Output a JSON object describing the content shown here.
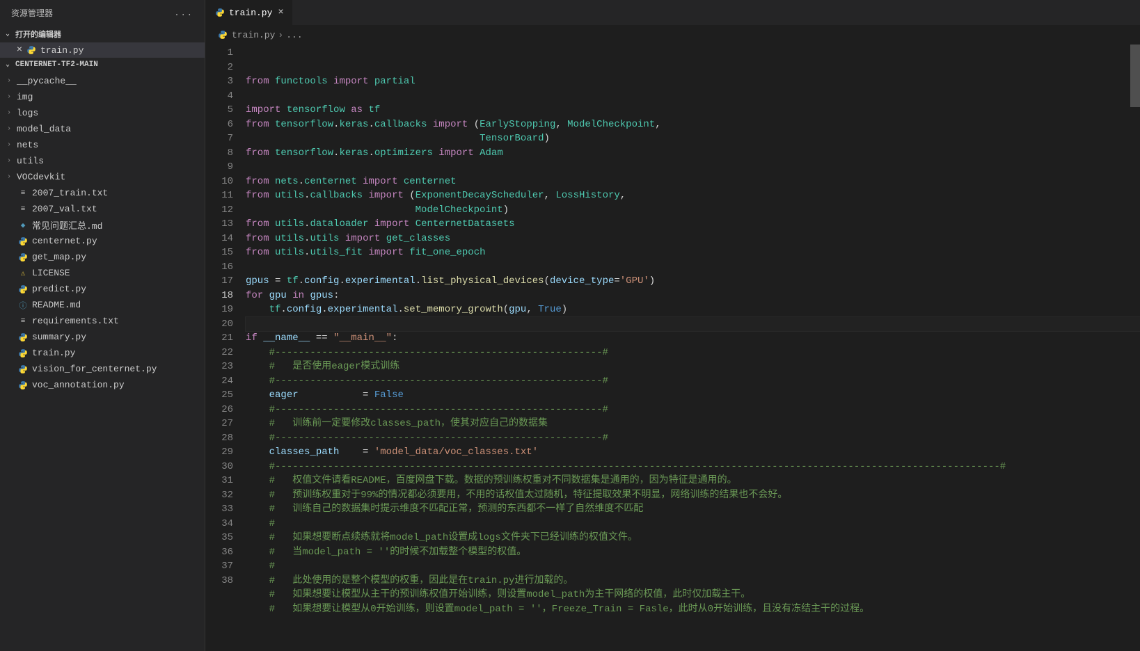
{
  "sidebar": {
    "title": "资源管理器",
    "moreActions": "...",
    "openEditors": {
      "label": "打开的编辑器",
      "items": [
        {
          "name": "train.py",
          "icon": "python"
        }
      ]
    },
    "project": {
      "name": "CENTERNET-TF2-MAIN",
      "tree": [
        {
          "type": "folder",
          "name": "__pycache__"
        },
        {
          "type": "folder",
          "name": "img"
        },
        {
          "type": "folder",
          "name": "logs"
        },
        {
          "type": "folder",
          "name": "model_data"
        },
        {
          "type": "folder",
          "name": "nets"
        },
        {
          "type": "folder",
          "name": "utils"
        },
        {
          "type": "folder",
          "name": "VOCdevkit"
        },
        {
          "type": "file",
          "name": "2007_train.txt",
          "icon": "text"
        },
        {
          "type": "file",
          "name": "2007_val.txt",
          "icon": "text"
        },
        {
          "type": "file",
          "name": "常见问题汇总.md",
          "icon": "md"
        },
        {
          "type": "file",
          "name": "centernet.py",
          "icon": "python"
        },
        {
          "type": "file",
          "name": "get_map.py",
          "icon": "python"
        },
        {
          "type": "file",
          "name": "LICENSE",
          "icon": "license"
        },
        {
          "type": "file",
          "name": "predict.py",
          "icon": "python"
        },
        {
          "type": "file",
          "name": "README.md",
          "icon": "info"
        },
        {
          "type": "file",
          "name": "requirements.txt",
          "icon": "text"
        },
        {
          "type": "file",
          "name": "summary.py",
          "icon": "python"
        },
        {
          "type": "file",
          "name": "train.py",
          "icon": "python"
        },
        {
          "type": "file",
          "name": "vision_for_centernet.py",
          "icon": "python"
        },
        {
          "type": "file",
          "name": "voc_annotation.py",
          "icon": "python"
        }
      ]
    }
  },
  "tabs": [
    {
      "name": "train.py",
      "icon": "python",
      "active": true
    }
  ],
  "breadcrumb": {
    "file": "train.py",
    "tail": "..."
  },
  "editor": {
    "activeLine": 18,
    "lines": [
      [
        [
          "kw",
          "from"
        ],
        [
          "plain",
          " "
        ],
        [
          "mod",
          "functools"
        ],
        [
          "plain",
          " "
        ],
        [
          "kw",
          "import"
        ],
        [
          "plain",
          " "
        ],
        [
          "mod",
          "partial"
        ]
      ],
      [],
      [
        [
          "kw",
          "import"
        ],
        [
          "plain",
          " "
        ],
        [
          "mod",
          "tensorflow"
        ],
        [
          "plain",
          " "
        ],
        [
          "kw",
          "as"
        ],
        [
          "plain",
          " "
        ],
        [
          "mod",
          "tf"
        ]
      ],
      [
        [
          "kw",
          "from"
        ],
        [
          "plain",
          " "
        ],
        [
          "mod",
          "tensorflow"
        ],
        [
          "op",
          "."
        ],
        [
          "mod",
          "keras"
        ],
        [
          "op",
          "."
        ],
        [
          "mod",
          "callbacks"
        ],
        [
          "plain",
          " "
        ],
        [
          "kw",
          "import"
        ],
        [
          "plain",
          " "
        ],
        [
          "pn",
          "("
        ],
        [
          "mod",
          "EarlyStopping"
        ],
        [
          "pn",
          ", "
        ],
        [
          "mod",
          "ModelCheckpoint"
        ],
        [
          "pn",
          ","
        ]
      ],
      [
        [
          "plain",
          "                                        "
        ],
        [
          "mod",
          "TensorBoard"
        ],
        [
          "pn",
          ")"
        ]
      ],
      [
        [
          "kw",
          "from"
        ],
        [
          "plain",
          " "
        ],
        [
          "mod",
          "tensorflow"
        ],
        [
          "op",
          "."
        ],
        [
          "mod",
          "keras"
        ],
        [
          "op",
          "."
        ],
        [
          "mod",
          "optimizers"
        ],
        [
          "plain",
          " "
        ],
        [
          "kw",
          "import"
        ],
        [
          "plain",
          " "
        ],
        [
          "mod",
          "Adam"
        ]
      ],
      [],
      [
        [
          "kw",
          "from"
        ],
        [
          "plain",
          " "
        ],
        [
          "mod",
          "nets"
        ],
        [
          "op",
          "."
        ],
        [
          "mod",
          "centernet"
        ],
        [
          "plain",
          " "
        ],
        [
          "kw",
          "import"
        ],
        [
          "plain",
          " "
        ],
        [
          "mod",
          "centernet"
        ]
      ],
      [
        [
          "kw",
          "from"
        ],
        [
          "plain",
          " "
        ],
        [
          "mod",
          "utils"
        ],
        [
          "op",
          "."
        ],
        [
          "mod",
          "callbacks"
        ],
        [
          "plain",
          " "
        ],
        [
          "kw",
          "import"
        ],
        [
          "plain",
          " "
        ],
        [
          "pn",
          "("
        ],
        [
          "mod",
          "ExponentDecayScheduler"
        ],
        [
          "pn",
          ", "
        ],
        [
          "mod",
          "LossHistory"
        ],
        [
          "pn",
          ","
        ]
      ],
      [
        [
          "plain",
          "                             "
        ],
        [
          "mod",
          "ModelCheckpoint"
        ],
        [
          "pn",
          ")"
        ]
      ],
      [
        [
          "kw",
          "from"
        ],
        [
          "plain",
          " "
        ],
        [
          "mod",
          "utils"
        ],
        [
          "op",
          "."
        ],
        [
          "mod",
          "dataloader"
        ],
        [
          "plain",
          " "
        ],
        [
          "kw",
          "import"
        ],
        [
          "plain",
          " "
        ],
        [
          "mod",
          "CenternetDatasets"
        ]
      ],
      [
        [
          "kw",
          "from"
        ],
        [
          "plain",
          " "
        ],
        [
          "mod",
          "utils"
        ],
        [
          "op",
          "."
        ],
        [
          "mod",
          "utils"
        ],
        [
          "plain",
          " "
        ],
        [
          "kw",
          "import"
        ],
        [
          "plain",
          " "
        ],
        [
          "mod",
          "get_classes"
        ]
      ],
      [
        [
          "kw",
          "from"
        ],
        [
          "plain",
          " "
        ],
        [
          "mod",
          "utils"
        ],
        [
          "op",
          "."
        ],
        [
          "mod",
          "utils_fit"
        ],
        [
          "plain",
          " "
        ],
        [
          "kw",
          "import"
        ],
        [
          "plain",
          " "
        ],
        [
          "mod",
          "fit_one_epoch"
        ]
      ],
      [],
      [
        [
          "var",
          "gpus"
        ],
        [
          "plain",
          " "
        ],
        [
          "op",
          "="
        ],
        [
          "plain",
          " "
        ],
        [
          "mod",
          "tf"
        ],
        [
          "op",
          "."
        ],
        [
          "var",
          "config"
        ],
        [
          "op",
          "."
        ],
        [
          "var",
          "experimental"
        ],
        [
          "op",
          "."
        ],
        [
          "fn",
          "list_physical_devices"
        ],
        [
          "pn",
          "("
        ],
        [
          "var",
          "device_type"
        ],
        [
          "op",
          "="
        ],
        [
          "str",
          "'GPU'"
        ],
        [
          "pn",
          ")"
        ]
      ],
      [
        [
          "kw",
          "for"
        ],
        [
          "plain",
          " "
        ],
        [
          "var",
          "gpu"
        ],
        [
          "plain",
          " "
        ],
        [
          "kw",
          "in"
        ],
        [
          "plain",
          " "
        ],
        [
          "var",
          "gpus"
        ],
        [
          "pn",
          ":"
        ]
      ],
      [
        [
          "plain",
          "    "
        ],
        [
          "mod",
          "tf"
        ],
        [
          "op",
          "."
        ],
        [
          "var",
          "config"
        ],
        [
          "op",
          "."
        ],
        [
          "var",
          "experimental"
        ],
        [
          "op",
          "."
        ],
        [
          "fn",
          "set_memory_growth"
        ],
        [
          "pn",
          "("
        ],
        [
          "var",
          "gpu"
        ],
        [
          "pn",
          ", "
        ],
        [
          "const",
          "True"
        ],
        [
          "pn",
          ")"
        ]
      ],
      [],
      [
        [
          "kw",
          "if"
        ],
        [
          "plain",
          " "
        ],
        [
          "var",
          "__name__"
        ],
        [
          "plain",
          " "
        ],
        [
          "op",
          "=="
        ],
        [
          "plain",
          " "
        ],
        [
          "str",
          "\"__main__\""
        ],
        [
          "pn",
          ":"
        ]
      ],
      [
        [
          "plain",
          "    "
        ],
        [
          "cmt",
          "#--------------------------------------------------------#"
        ]
      ],
      [
        [
          "plain",
          "    "
        ],
        [
          "cmt",
          "#   是否使用eager模式训练"
        ]
      ],
      [
        [
          "plain",
          "    "
        ],
        [
          "cmt",
          "#--------------------------------------------------------#"
        ]
      ],
      [
        [
          "plain",
          "    "
        ],
        [
          "var",
          "eager"
        ],
        [
          "plain",
          "           "
        ],
        [
          "op",
          "="
        ],
        [
          "plain",
          " "
        ],
        [
          "const",
          "False"
        ]
      ],
      [
        [
          "plain",
          "    "
        ],
        [
          "cmt",
          "#--------------------------------------------------------#"
        ]
      ],
      [
        [
          "plain",
          "    "
        ],
        [
          "cmt",
          "#   训练前一定要修改classes_path，使其对应自己的数据集"
        ]
      ],
      [
        [
          "plain",
          "    "
        ],
        [
          "cmt",
          "#--------------------------------------------------------#"
        ]
      ],
      [
        [
          "plain",
          "    "
        ],
        [
          "var",
          "classes_path"
        ],
        [
          "plain",
          "    "
        ],
        [
          "op",
          "="
        ],
        [
          "plain",
          " "
        ],
        [
          "str",
          "'model_data/voc_classes.txt'"
        ]
      ],
      [
        [
          "plain",
          "    "
        ],
        [
          "cmt",
          "#----------------------------------------------------------------------------------------------------------------------------#"
        ]
      ],
      [
        [
          "plain",
          "    "
        ],
        [
          "cmt",
          "#   权值文件请看README，百度网盘下载。数据的预训练权重对不同数据集是通用的，因为特征是通用的。"
        ]
      ],
      [
        [
          "plain",
          "    "
        ],
        [
          "cmt",
          "#   预训练权重对于99%的情况都必须要用，不用的话权值太过随机，特征提取效果不明显，网络训练的结果也不会好。"
        ]
      ],
      [
        [
          "plain",
          "    "
        ],
        [
          "cmt",
          "#   训练自己的数据集时提示维度不匹配正常，预测的东西都不一样了自然维度不匹配"
        ]
      ],
      [
        [
          "plain",
          "    "
        ],
        [
          "cmt",
          "#"
        ]
      ],
      [
        [
          "plain",
          "    "
        ],
        [
          "cmt",
          "#   如果想要断点续练就将model_path设置成logs文件夹下已经训练的权值文件。"
        ]
      ],
      [
        [
          "plain",
          "    "
        ],
        [
          "cmt",
          "#   当model_path = ''的时候不加载整个模型的权值。"
        ]
      ],
      [
        [
          "plain",
          "    "
        ],
        [
          "cmt",
          "#"
        ]
      ],
      [
        [
          "plain",
          "    "
        ],
        [
          "cmt",
          "#   此处使用的是整个模型的权重，因此是在train.py进行加载的。"
        ]
      ],
      [
        [
          "plain",
          "    "
        ],
        [
          "cmt",
          "#   如果想要让模型从主干的预训练权值开始训练，则设置model_path为主干网络的权值，此时仅加载主干。"
        ]
      ],
      [
        [
          "plain",
          "    "
        ],
        [
          "cmt",
          "#   如果想要让模型从0开始训练，则设置model_path = ''，Freeze_Train = Fasle，此时从0开始训练，且没有冻结主干的过程。"
        ]
      ]
    ]
  },
  "icons": {
    "python": "🐍",
    "text": "≡",
    "md": "◆",
    "license": "⚖",
    "info": "ⓘ"
  }
}
